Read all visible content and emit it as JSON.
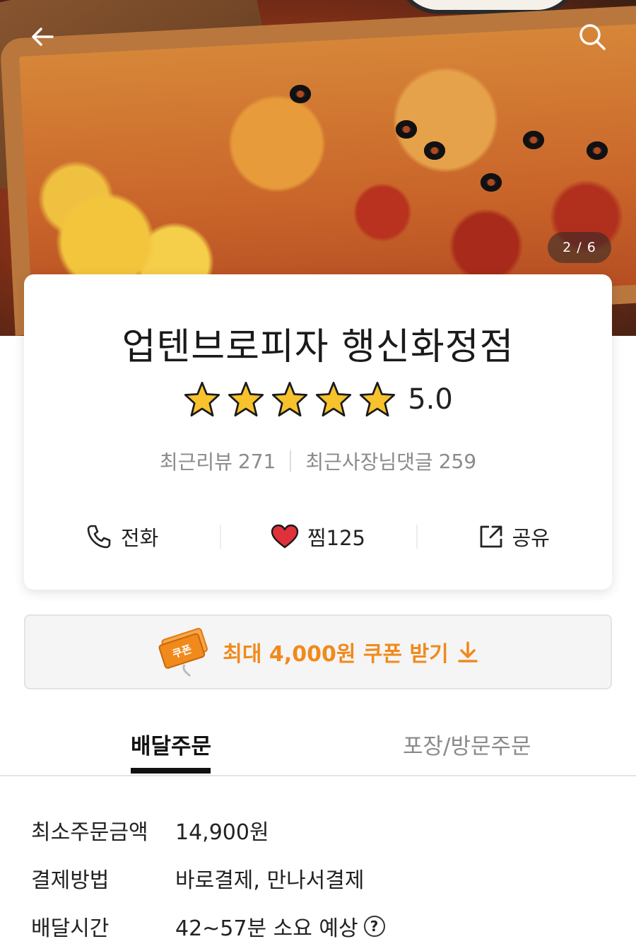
{
  "hero": {
    "page_indicator": "2 / 6",
    "icons": [
      "back-arrow-icon",
      "search-icon"
    ]
  },
  "store": {
    "name": "업텐브로피자 행신화정점",
    "rating": 5.0,
    "rating_text": "5.0",
    "stars_filled": 5,
    "recent_reviews_label": "최근리뷰",
    "recent_reviews_count": "271",
    "owner_comments_label": "최근사장님댓글",
    "owner_comments_count": "259"
  },
  "actions": {
    "call_label": "전화",
    "like_label": "찜125",
    "share_label": "공유"
  },
  "coupon": {
    "badge_text": "쿠폰",
    "text": "최대 4,000원 쿠폰 받기"
  },
  "tabs": [
    {
      "label": "배달주문",
      "active": true
    },
    {
      "label": "포장/방문주문",
      "active": false
    }
  ],
  "info": [
    {
      "label": "최소주문금액",
      "value": "14,900원"
    },
    {
      "label": "결제방법",
      "value": "바로결제, 만나서결제"
    },
    {
      "label": "배달시간",
      "value": "42~57분 소요 예상"
    }
  ],
  "colors": {
    "accent_orange": "#f08a1c",
    "heart_red": "#e0313b",
    "star_yellow": "#f7c22c"
  }
}
